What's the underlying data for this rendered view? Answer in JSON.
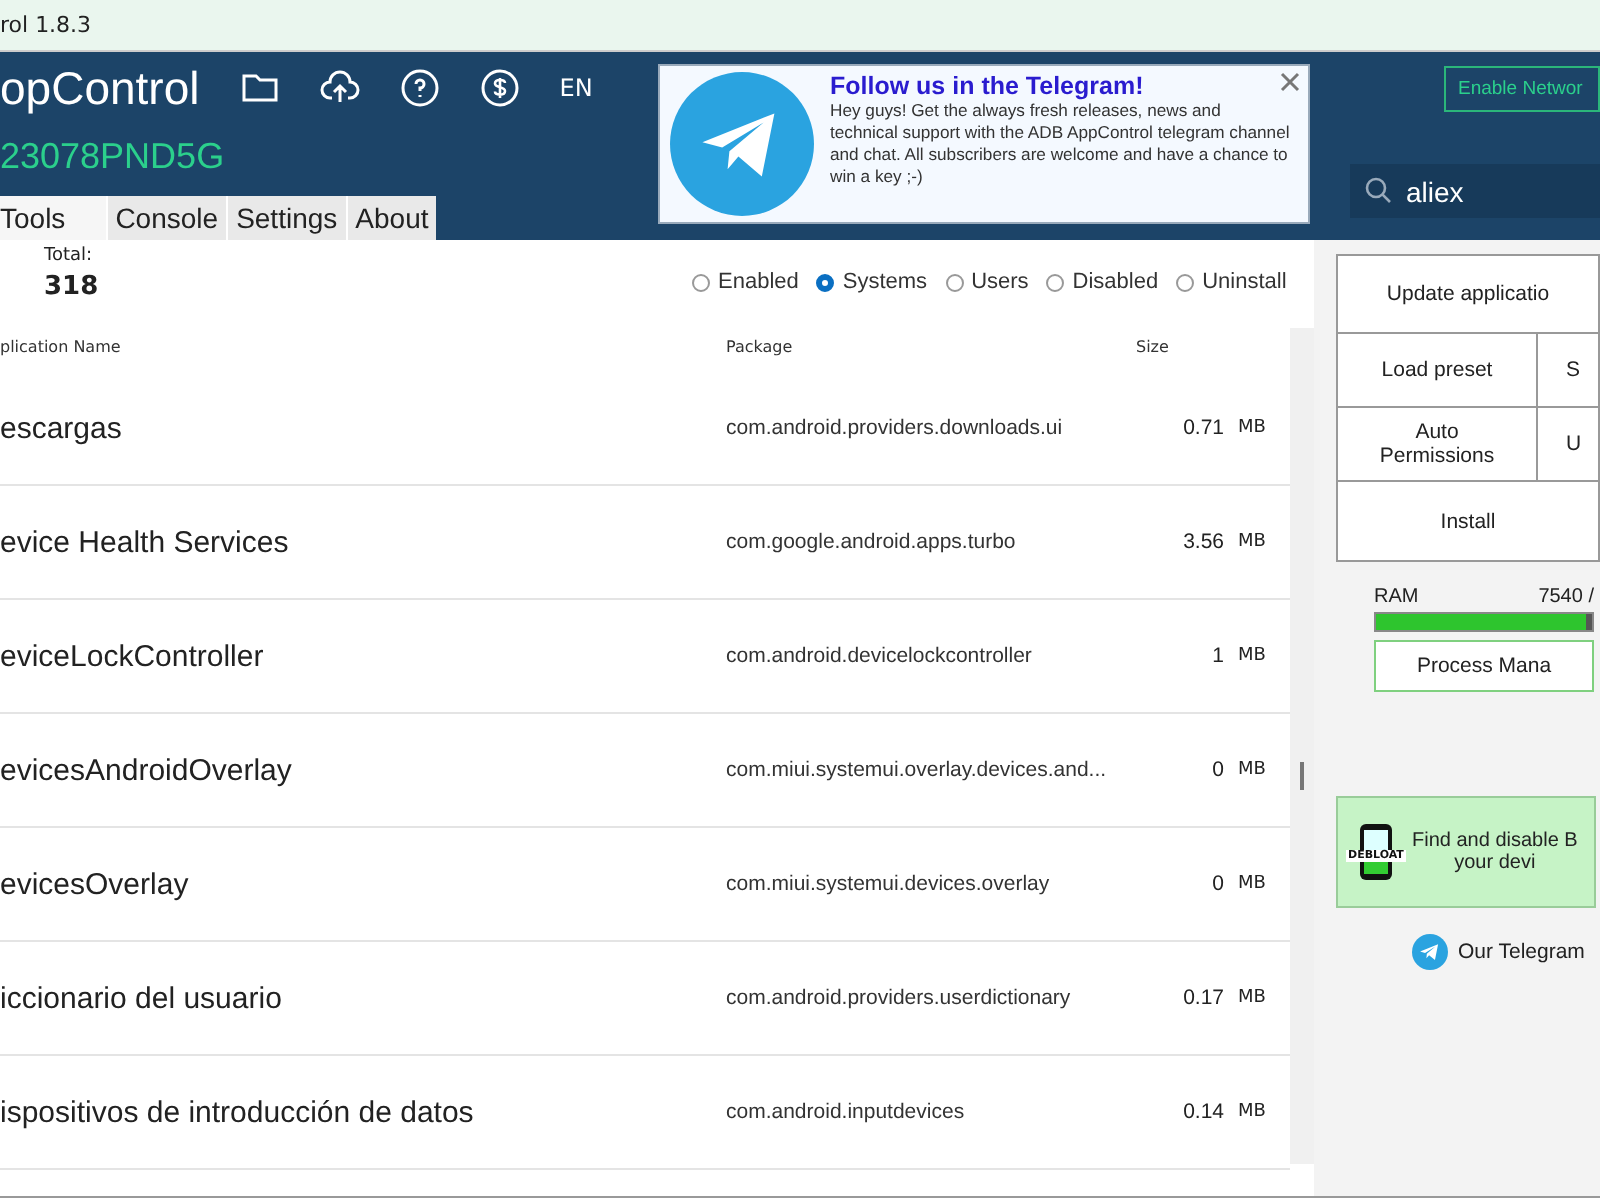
{
  "window": {
    "title": "rol 1.8.3"
  },
  "header": {
    "app_name": "opControl",
    "device_id": "23078PND5G",
    "language": "EN",
    "tabs": [
      {
        "label": "Tools",
        "selected": true
      },
      {
        "label": "Console",
        "selected": false
      },
      {
        "label": "Settings",
        "selected": false
      },
      {
        "label": "About",
        "selected": false
      }
    ]
  },
  "banner": {
    "title": "Follow us in the Telegram!",
    "text": "Hey guys! Get the always fresh releases, news and technical support with the ADB AppControl telegram channel and chat. All subscribers are welcome and have a chance to win a key ;-)"
  },
  "network_button": "Enable Networ",
  "search": {
    "value": "aliex"
  },
  "total": {
    "label": "Total:",
    "value": "318"
  },
  "filters": [
    {
      "label": "Enabled",
      "selected": false
    },
    {
      "label": "Systems",
      "selected": true
    },
    {
      "label": "Users",
      "selected": false
    },
    {
      "label": "Disabled",
      "selected": false
    },
    {
      "label": "Uninstall",
      "selected": false
    }
  ],
  "table": {
    "columns": [
      "plication Name",
      "Package",
      "Size"
    ],
    "rows": [
      {
        "name": "escargas",
        "package": "com.android.providers.downloads.ui",
        "size": "0.71",
        "unit": "MB"
      },
      {
        "name": "evice Health Services",
        "package": "com.google.android.apps.turbo",
        "size": "3.56",
        "unit": "MB"
      },
      {
        "name": "eviceLockController",
        "package": "com.android.devicelockcontroller",
        "size": "1",
        "unit": "MB"
      },
      {
        "name": "evicesAndroidOverlay",
        "package": "com.miui.systemui.overlay.devices.and...",
        "size": "0",
        "unit": "MB"
      },
      {
        "name": "evicesOverlay",
        "package": "com.miui.systemui.devices.overlay",
        "size": "0",
        "unit": "MB"
      },
      {
        "name": "iccionario del usuario",
        "package": "com.android.providers.userdictionary",
        "size": "0.17",
        "unit": "MB"
      },
      {
        "name": "ispositivos de introducción de datos",
        "package": "com.android.inputdevices",
        "size": "0.14",
        "unit": "MB"
      }
    ]
  },
  "actions": {
    "update": "Update applicatio",
    "grid": [
      "Load preset",
      "S",
      "Auto Permissions",
      "U"
    ],
    "install": "Install"
  },
  "ram": {
    "label": "RAM",
    "reading": "7540 /",
    "level": 0.97
  },
  "process_button": "Process Mana",
  "debloat": {
    "lines": [
      "Find and disable B",
      "your devi"
    ],
    "badge": "DEBLOAT"
  },
  "telegram_link": "Our Telegram"
}
